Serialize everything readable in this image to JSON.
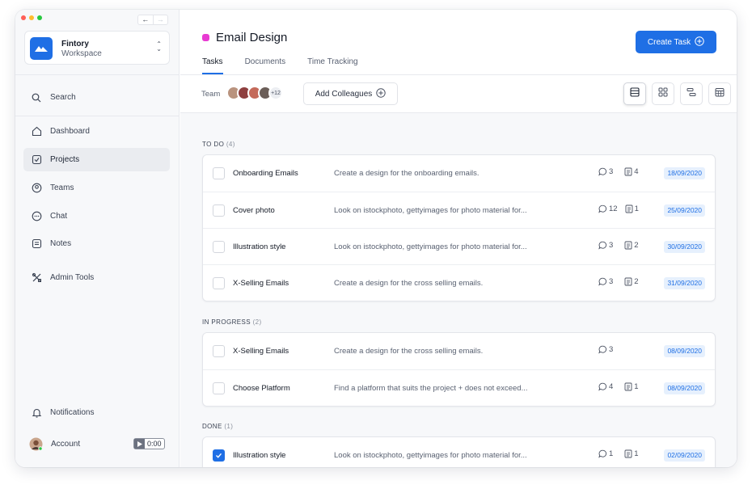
{
  "window": {
    "lights": [
      "#ff5f57",
      "#febc2e",
      "#28c840"
    ]
  },
  "sidebar": {
    "workspace": {
      "name": "Fintory",
      "subtitle": "Workspace"
    },
    "search": "Search",
    "items": [
      {
        "label": "Dashboard",
        "icon": "home-icon"
      },
      {
        "label": "Projects",
        "icon": "check-square-icon",
        "active": true
      },
      {
        "label": "Teams",
        "icon": "user-circle-icon"
      },
      {
        "label": "Chat",
        "icon": "chat-icon"
      },
      {
        "label": "Notes",
        "icon": "notes-icon"
      },
      {
        "label": "Admin Tools",
        "icon": "tools-icon"
      }
    ],
    "notifications": "Notifications",
    "account": "Account",
    "timer": "0:00"
  },
  "header": {
    "project_title": "Email Design",
    "project_color": "#e83ad2",
    "tabs": [
      "Tasks",
      "Documents",
      "Time Tracking"
    ],
    "create_button": "Create Task",
    "team_label": "Team",
    "team_more": "+12",
    "add_colleagues": "Add Colleagues"
  },
  "sections": [
    {
      "label": "TO DO",
      "count": "(4)",
      "tasks": [
        {
          "name": "Onboarding Emails",
          "desc": "Create a design for the onboarding emails.",
          "comments": "3",
          "files": "4",
          "date": "18/09/2020",
          "done": false
        },
        {
          "name": "Cover photo",
          "desc": "Look on istockphoto, gettyimages for photo material for...",
          "comments": "12",
          "files": "1",
          "date": "25/09/2020",
          "done": false
        },
        {
          "name": "Illustration style",
          "desc": "Look on istockphoto, gettyimages for photo material for...",
          "comments": "3",
          "files": "2",
          "date": "30/09/2020",
          "done": false
        },
        {
          "name": "X-Selling Emails",
          "desc": "Create a design for the cross selling emails.",
          "comments": "3",
          "files": "2",
          "date": "31/09/2020",
          "done": false
        }
      ]
    },
    {
      "label": "IN PROGRESS",
      "count": "(2)",
      "tasks": [
        {
          "name": "X-Selling Emails",
          "desc": "Create a design for the cross selling emails.",
          "comments": "3",
          "files": "",
          "date": "08/09/2020",
          "done": false
        },
        {
          "name": "Choose Platform",
          "desc": "Find a platform that suits the project + does not exceed...",
          "comments": "4",
          "files": "1",
          "date": "08/09/2020",
          "done": false
        }
      ]
    },
    {
      "label": "DONE",
      "count": "(1)",
      "tasks": [
        {
          "name": "Illustration style",
          "desc": "Look on istockphoto, gettyimages for photo material for...",
          "comments": "1",
          "files": "1",
          "date": "02/09/2020",
          "done": true
        }
      ]
    }
  ]
}
